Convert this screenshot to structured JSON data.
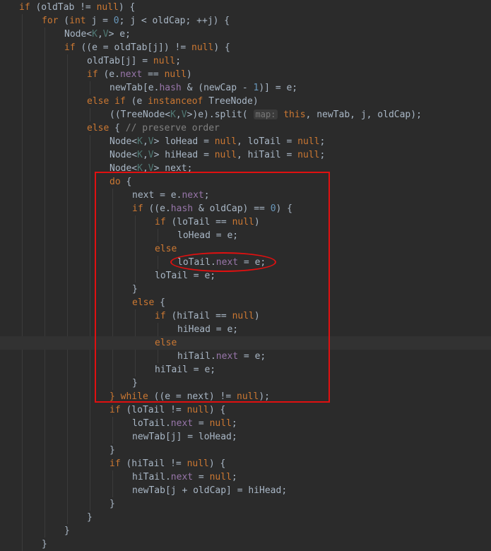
{
  "annotations": {
    "rectangle_color": "#e01010",
    "ellipse_color": "#e01010"
  },
  "theme": {
    "background": "#2b2b2b",
    "text": "#a9b7c6",
    "keyword": "#cc7832",
    "number": "#6897bb",
    "field": "#9876aa",
    "generic": "#507874",
    "comment": "#808080"
  },
  "lines": [
    {
      "indent": 0,
      "tokens": [
        {
          "t": "if",
          "c": "kw"
        },
        {
          "t": " (oldTab != "
        },
        {
          "t": "null",
          "c": "kw"
        },
        {
          "t": ") {"
        }
      ]
    },
    {
      "indent": 1,
      "tokens": [
        {
          "t": "for",
          "c": "kw"
        },
        {
          "t": " ("
        },
        {
          "t": "int",
          "c": "kw"
        },
        {
          "t": " j = "
        },
        {
          "t": "0",
          "c": "num"
        },
        {
          "t": "; j < oldCap; ++j) {"
        }
      ]
    },
    {
      "indent": 2,
      "tokens": [
        {
          "t": "Node<"
        },
        {
          "t": "K",
          "c": "gen"
        },
        {
          "t": ","
        },
        {
          "t": "V",
          "c": "gen"
        },
        {
          "t": "> e;"
        }
      ]
    },
    {
      "indent": 2,
      "tokens": [
        {
          "t": "if",
          "c": "kw"
        },
        {
          "t": " ((e = oldTab[j]) != "
        },
        {
          "t": "null",
          "c": "kw"
        },
        {
          "t": ") {"
        }
      ]
    },
    {
      "indent": 3,
      "tokens": [
        {
          "t": "oldTab[j] = "
        },
        {
          "t": "null",
          "c": "kw"
        },
        {
          "t": ";"
        }
      ]
    },
    {
      "indent": 3,
      "tokens": [
        {
          "t": "if",
          "c": "kw"
        },
        {
          "t": " (e."
        },
        {
          "t": "next",
          "c": "fld"
        },
        {
          "t": " == "
        },
        {
          "t": "null",
          "c": "kw"
        },
        {
          "t": ")"
        }
      ]
    },
    {
      "indent": 4,
      "tokens": [
        {
          "t": "newTab[e."
        },
        {
          "t": "hash",
          "c": "fld"
        },
        {
          "t": " & (newCap - "
        },
        {
          "t": "1",
          "c": "num"
        },
        {
          "t": ")] = e;"
        }
      ]
    },
    {
      "indent": 3,
      "tokens": [
        {
          "t": "else if",
          "c": "kw"
        },
        {
          "t": " (e "
        },
        {
          "t": "instanceof",
          "c": "kw"
        },
        {
          "t": " TreeNode)"
        }
      ]
    },
    {
      "indent": 4,
      "tokens": [
        {
          "t": "((TreeNode<"
        },
        {
          "t": "K",
          "c": "gen"
        },
        {
          "t": ","
        },
        {
          "t": "V",
          "c": "gen"
        },
        {
          "t": ">)e).split( "
        },
        {
          "t": "map:",
          "c": "hint"
        },
        {
          "t": " "
        },
        {
          "t": "this",
          "c": "kw"
        },
        {
          "t": ", newTab, j, oldCap);"
        }
      ]
    },
    {
      "indent": 3,
      "tokens": [
        {
          "t": "else",
          "c": "kw"
        },
        {
          "t": " { "
        },
        {
          "t": "// preserve order",
          "c": "cmt"
        }
      ]
    },
    {
      "indent": 4,
      "tokens": [
        {
          "t": "Node<"
        },
        {
          "t": "K",
          "c": "gen"
        },
        {
          "t": ","
        },
        {
          "t": "V",
          "c": "gen"
        },
        {
          "t": "> loHead = "
        },
        {
          "t": "null",
          "c": "kw"
        },
        {
          "t": ", loTail = "
        },
        {
          "t": "null",
          "c": "kw"
        },
        {
          "t": ";"
        }
      ]
    },
    {
      "indent": 4,
      "tokens": [
        {
          "t": "Node<"
        },
        {
          "t": "K",
          "c": "gen"
        },
        {
          "t": ","
        },
        {
          "t": "V",
          "c": "gen"
        },
        {
          "t": "> hiHead = "
        },
        {
          "t": "null",
          "c": "kw"
        },
        {
          "t": ", hiTail = "
        },
        {
          "t": "null",
          "c": "kw"
        },
        {
          "t": ";"
        }
      ]
    },
    {
      "indent": 4,
      "tokens": [
        {
          "t": "Node<"
        },
        {
          "t": "K",
          "c": "gen"
        },
        {
          "t": ","
        },
        {
          "t": "V",
          "c": "gen"
        },
        {
          "t": "> next;"
        }
      ]
    },
    {
      "indent": 4,
      "tokens": [
        {
          "t": "do",
          "c": "kw"
        },
        {
          "t": " {"
        }
      ]
    },
    {
      "indent": 5,
      "tokens": [
        {
          "t": "next = e."
        },
        {
          "t": "next",
          "c": "fld"
        },
        {
          "t": ";"
        }
      ]
    },
    {
      "indent": 5,
      "tokens": [
        {
          "t": "if",
          "c": "kw"
        },
        {
          "t": " ((e."
        },
        {
          "t": "hash",
          "c": "fld"
        },
        {
          "t": " & oldCap) == "
        },
        {
          "t": "0",
          "c": "num"
        },
        {
          "t": ") {"
        }
      ]
    },
    {
      "indent": 6,
      "tokens": [
        {
          "t": "if",
          "c": "kw"
        },
        {
          "t": " (loTail == "
        },
        {
          "t": "null",
          "c": "kw"
        },
        {
          "t": ")"
        }
      ]
    },
    {
      "indent": 7,
      "tokens": [
        {
          "t": "loHead = e;"
        }
      ]
    },
    {
      "indent": 6,
      "tokens": [
        {
          "t": "else",
          "c": "kw"
        }
      ]
    },
    {
      "indent": 7,
      "tokens": [
        {
          "t": "loTail."
        },
        {
          "t": "next",
          "c": "fld"
        },
        {
          "t": " = e;"
        }
      ]
    },
    {
      "indent": 6,
      "tokens": [
        {
          "t": "loTail = e;"
        }
      ]
    },
    {
      "indent": 5,
      "tokens": [
        {
          "t": "}"
        }
      ]
    },
    {
      "indent": 5,
      "tokens": [
        {
          "t": "else",
          "c": "kw"
        },
        {
          "t": " {"
        }
      ]
    },
    {
      "indent": 6,
      "tokens": [
        {
          "t": "if",
          "c": "kw"
        },
        {
          "t": " (hiTail == "
        },
        {
          "t": "null",
          "c": "kw"
        },
        {
          "t": ")"
        }
      ]
    },
    {
      "indent": 7,
      "tokens": [
        {
          "t": "hiHead = e;"
        }
      ]
    },
    {
      "indent": 6,
      "tokens": [
        {
          "t": "else",
          "c": "kw"
        }
      ]
    },
    {
      "indent": 7,
      "tokens": [
        {
          "t": "hiTail."
        },
        {
          "t": "next",
          "c": "fld"
        },
        {
          "t": " = e;"
        }
      ]
    },
    {
      "indent": 6,
      "tokens": [
        {
          "t": "hiTail = e;"
        }
      ]
    },
    {
      "indent": 5,
      "tokens": [
        {
          "t": "}"
        }
      ]
    },
    {
      "indent": 4,
      "tokens": [
        {
          "t": "}",
          "c": "kw"
        },
        {
          "t": " "
        },
        {
          "t": "while",
          "c": "kw"
        },
        {
          "t": " ((e = next) != "
        },
        {
          "t": "null",
          "c": "kw"
        },
        {
          "t": ");"
        }
      ]
    },
    {
      "indent": 4,
      "tokens": [
        {
          "t": "if",
          "c": "kw"
        },
        {
          "t": " (loTail != "
        },
        {
          "t": "null",
          "c": "kw"
        },
        {
          "t": ") {"
        }
      ]
    },
    {
      "indent": 5,
      "tokens": [
        {
          "t": "loTail."
        },
        {
          "t": "next",
          "c": "fld"
        },
        {
          "t": " = "
        },
        {
          "t": "null",
          "c": "kw"
        },
        {
          "t": ";"
        }
      ]
    },
    {
      "indent": 5,
      "tokens": [
        {
          "t": "newTab[j] = loHead;"
        }
      ]
    },
    {
      "indent": 4,
      "tokens": [
        {
          "t": "}"
        }
      ]
    },
    {
      "indent": 4,
      "tokens": [
        {
          "t": "if",
          "c": "kw"
        },
        {
          "t": " (hiTail != "
        },
        {
          "t": "null",
          "c": "kw"
        },
        {
          "t": ") {"
        }
      ]
    },
    {
      "indent": 5,
      "tokens": [
        {
          "t": "hiTail."
        },
        {
          "t": "next",
          "c": "fld"
        },
        {
          "t": " = "
        },
        {
          "t": "null",
          "c": "kw"
        },
        {
          "t": ";"
        }
      ]
    },
    {
      "indent": 5,
      "tokens": [
        {
          "t": "newTab[j + oldCap] = hiHead;"
        }
      ]
    },
    {
      "indent": 4,
      "tokens": [
        {
          "t": "}"
        }
      ]
    },
    {
      "indent": 3,
      "tokens": [
        {
          "t": "}"
        }
      ]
    },
    {
      "indent": 2,
      "tokens": [
        {
          "t": "}"
        }
      ]
    },
    {
      "indent": 1,
      "tokens": [
        {
          "t": "}"
        }
      ]
    }
  ]
}
